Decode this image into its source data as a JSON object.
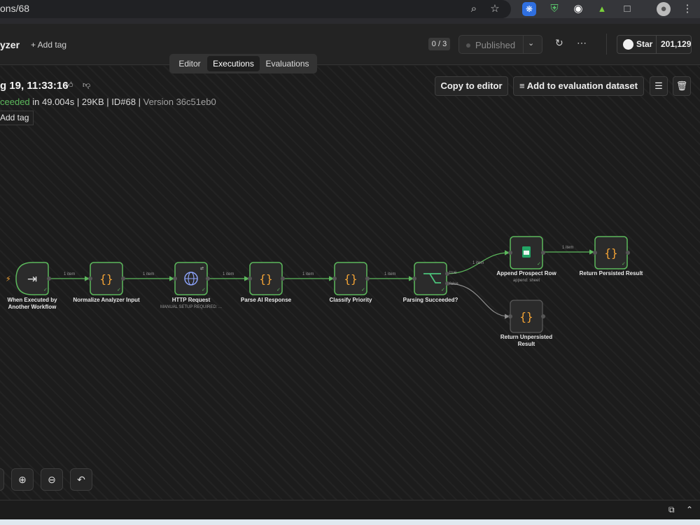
{
  "browser": {
    "url_fragment": "ons/68",
    "icons": [
      "zoom-icon",
      "bookmark-star-icon",
      "extension-gear-icon",
      "extension-shield-icon",
      "extension-robot-icon",
      "extension-chart-icon",
      "extensions-puzzle-icon",
      "profile-avatar-icon",
      "browser-menu-icon"
    ]
  },
  "header": {
    "workflow_name": "yzer",
    "add_tag": "+ Add tag",
    "counter": "0 / 3",
    "published": "Published",
    "star_label": "Star",
    "star_count": "201,129"
  },
  "tabs": [
    {
      "label": "Editor",
      "active": false
    },
    {
      "label": "Executions",
      "active": true
    },
    {
      "label": "Evaluations",
      "active": false
    }
  ],
  "execution": {
    "title": "g 19, 11:33:16",
    "status": "ceeded",
    "duration": " in 49.004s",
    "size": "29KB",
    "id": "ID#68",
    "version": "Version 36c51eb0",
    "add_tag": "Add tag",
    "copy_to_editor": "Copy to editor",
    "add_to_dataset": "Add to evaluation dataset"
  },
  "nodes": [
    {
      "label_lines": [
        "When Executed by",
        "Another Workflow"
      ],
      "sub": "",
      "icon": "enter-arrow-icon"
    },
    {
      "label_lines": [
        "Normalize Analyzer Input"
      ],
      "sub": "",
      "icon": "code-braces-icon"
    },
    {
      "label_lines": [
        "HTTP Request"
      ],
      "sub": "MANUAL SETUP REQUIRED: ...",
      "icon": "globe-icon"
    },
    {
      "label_lines": [
        "Parse AI Response"
      ],
      "sub": "",
      "icon": "code-braces-icon"
    },
    {
      "label_lines": [
        "Classify Priority"
      ],
      "sub": "",
      "icon": "code-braces-icon"
    },
    {
      "label_lines": [
        "Parsing Succeeded?"
      ],
      "sub": "",
      "icon": "branch-if-icon"
    },
    {
      "label_lines": [
        "Append Prospect Row"
      ],
      "sub": "append: sheet",
      "icon": "sheets-icon"
    },
    {
      "label_lines": [
        "Return Persisted Result"
      ],
      "sub": "",
      "icon": "code-braces-icon"
    },
    {
      "label_lines": [
        "Return Unpersisted",
        "Result"
      ],
      "sub": "",
      "icon": "code-braces-icon"
    }
  ],
  "edges": {
    "item_label": "1 item",
    "true_label": "true",
    "false_label": "false"
  },
  "colors": {
    "success": "#5cb85c",
    "code_icon": "#f3a335",
    "canvas": "#1c1c1c"
  }
}
